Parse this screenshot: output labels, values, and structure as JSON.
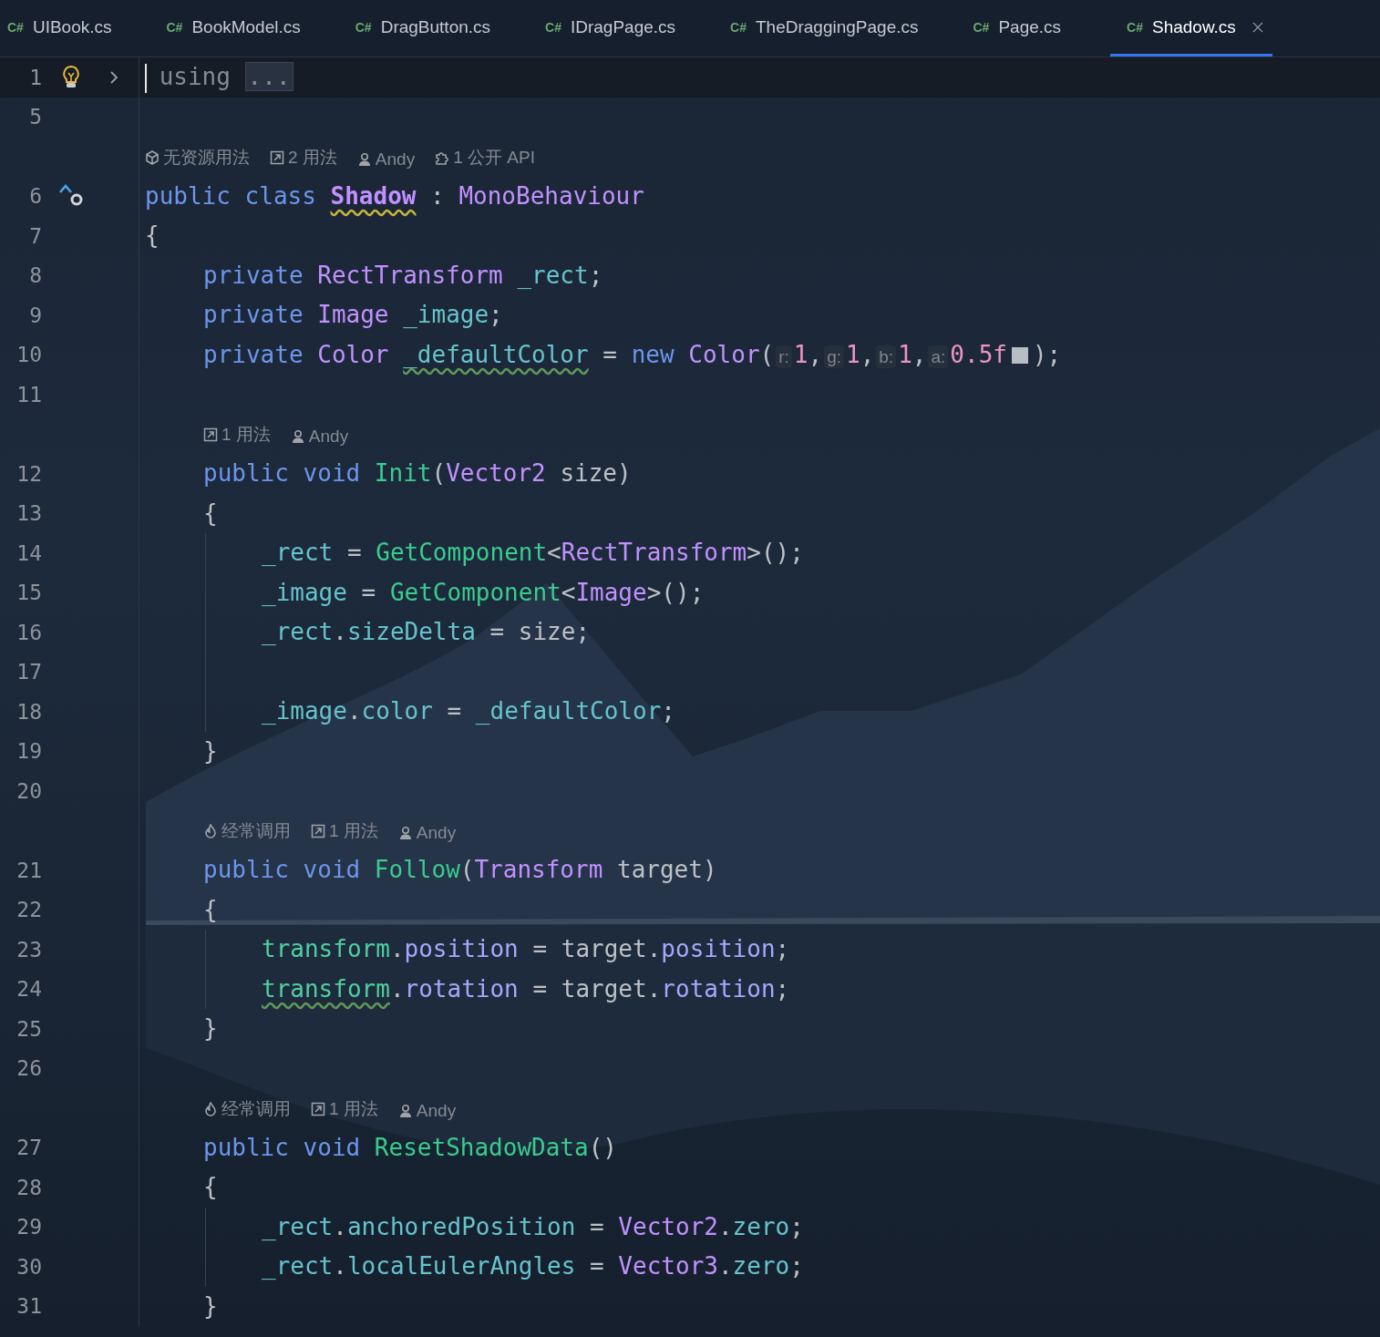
{
  "tabs": [
    {
      "icon": "C#",
      "label": "UIBook.cs",
      "selected": false
    },
    {
      "icon": "C#",
      "label": "BookModel.cs",
      "selected": false
    },
    {
      "icon": "C#",
      "label": "DragButton.cs",
      "selected": false
    },
    {
      "icon": "C#",
      "label": "IDragPage.cs",
      "selected": false
    },
    {
      "icon": "C#",
      "label": "TheDraggingPage.cs",
      "selected": false
    },
    {
      "icon": "C#",
      "label": "Page.cs",
      "selected": false
    },
    {
      "icon": "C#",
      "label": "Shadow.cs",
      "selected": true
    }
  ],
  "lines": [
    {
      "kind": "code",
      "number": "1",
      "current": true,
      "caret": true,
      "gutter": {
        "kind": "bulb"
      },
      "folded": true,
      "words": [
        [
          {
            "kind": "dim",
            "text": "using"
          }
        ],
        [
          {
            "kind": "folded",
            "text": "..."
          }
        ]
      ]
    },
    {
      "kind": "code",
      "number": "5"
    },
    {
      "kind": "hint",
      "items": [
        {
          "kind": "unity",
          "text": "无资源用法"
        },
        {
          "kind": "usages",
          "text": "2 用法"
        },
        {
          "kind": "author",
          "text": "Andy"
        },
        {
          "kind": "api",
          "text": "1 公开 API"
        }
      ]
    },
    {
      "kind": "code",
      "number": "6",
      "gutter": {
        "kind": "implements"
      },
      "words": [
        [
          {
            "kind": "keyword",
            "text": "public"
          }
        ],
        [
          {
            "kind": "keyword",
            "text": "class"
          }
        ],
        [
          {
            "kind": "class",
            "text": "Shadow",
            "warning": true
          }
        ],
        [
          {
            "kind": "plain",
            "text": ":"
          }
        ],
        [
          {
            "kind": "type",
            "text": "MonoBehaviour"
          }
        ]
      ]
    },
    {
      "kind": "code",
      "number": "7",
      "words": [
        [
          {
            "kind": "plain",
            "text": "{"
          }
        ]
      ],
      "children": [
        {
          "kind": "code",
          "number": "8",
          "words": [
            [
              {
                "kind": "keyword",
                "text": "private"
              }
            ],
            [
              {
                "kind": "type",
                "text": "RectTransform"
              }
            ],
            [
              {
                "kind": "field",
                "text": "_rect"
              },
              {
                "kind": "plain",
                "text": ";"
              }
            ]
          ]
        },
        {
          "kind": "code",
          "number": "9",
          "words": [
            [
              {
                "kind": "keyword",
                "text": "private"
              }
            ],
            [
              {
                "kind": "type",
                "text": "Image"
              }
            ],
            [
              {
                "kind": "field",
                "text": "_image"
              },
              {
                "kind": "plain",
                "text": ";"
              }
            ]
          ]
        },
        {
          "kind": "code",
          "number": "10",
          "words": [
            [
              {
                "kind": "keyword",
                "text": "private"
              }
            ],
            [
              {
                "kind": "type",
                "text": "Color"
              }
            ],
            [
              {
                "kind": "field",
                "text": "_defaultColor",
                "weak_warning": true
              }
            ],
            [
              {
                "kind": "plain",
                "text": "="
              }
            ],
            [
              {
                "kind": "keyword",
                "text": "new"
              }
            ],
            [
              {
                "kind": "type",
                "text": "Color"
              },
              {
                "kind": "plain",
                "text": "("
              },
              {
                "kind": "param",
                "text": "r:"
              },
              {
                "kind": "number",
                "text": "1"
              },
              {
                "kind": "plain",
                "text": ","
              },
              {
                "kind": "param",
                "text": "g:"
              },
              {
                "kind": "number",
                "text": "1"
              },
              {
                "kind": "plain",
                "text": ","
              },
              {
                "kind": "param",
                "text": "b:"
              },
              {
                "kind": "number",
                "text": "1"
              },
              {
                "kind": "plain",
                "text": ","
              },
              {
                "kind": "param",
                "text": "a:"
              },
              {
                "kind": "number",
                "text": "0.5f"
              },
              {
                "kind": "swatch"
              },
              {
                "kind": "plain",
                "text": ");"
              }
            ]
          ]
        },
        {
          "kind": "code",
          "number": "11"
        },
        {
          "kind": "hint",
          "items": [
            {
              "kind": "usages",
              "text": "1 用法"
            },
            {
              "kind": "author",
              "text": "Andy"
            }
          ]
        },
        {
          "kind": "code",
          "number": "12",
          "words": [
            [
              {
                "kind": "keyword",
                "text": "public"
              }
            ],
            [
              {
                "kind": "keyword",
                "text": "void"
              }
            ],
            [
              {
                "kind": "method",
                "text": "Init"
              },
              {
                "kind": "plain",
                "text": "("
              },
              {
                "kind": "type",
                "text": "Vector2"
              }
            ],
            [
              {
                "kind": "plain",
                "text": "size)"
              }
            ]
          ]
        },
        {
          "kind": "code",
          "number": "13",
          "words": [
            [
              {
                "kind": "plain",
                "text": "{"
              }
            ]
          ],
          "children": [
            {
              "kind": "code",
              "number": "14",
              "words": [
                [
                  {
                    "kind": "field",
                    "text": "_rect"
                  }
                ],
                [
                  {
                    "kind": "plain",
                    "text": "="
                  }
                ],
                [
                  {
                    "kind": "method",
                    "text": "GetComponent"
                  },
                  {
                    "kind": "plain",
                    "text": "<"
                  },
                  {
                    "kind": "type",
                    "text": "RectTransform"
                  },
                  {
                    "kind": "plain",
                    "text": ">();"
                  }
                ]
              ]
            },
            {
              "kind": "code",
              "number": "15",
              "words": [
                [
                  {
                    "kind": "field",
                    "text": "_image"
                  }
                ],
                [
                  {
                    "kind": "plain",
                    "text": "="
                  }
                ],
                [
                  {
                    "kind": "method",
                    "text": "GetComponent"
                  },
                  {
                    "kind": "plain",
                    "text": "<"
                  },
                  {
                    "kind": "type",
                    "text": "Image"
                  },
                  {
                    "kind": "plain",
                    "text": ">();"
                  }
                ]
              ]
            },
            {
              "kind": "code",
              "number": "16",
              "words": [
                [
                  {
                    "kind": "field",
                    "text": "_rect"
                  },
                  {
                    "kind": "plain",
                    "text": "."
                  },
                  {
                    "kind": "field",
                    "text": "sizeDelta"
                  }
                ],
                [
                  {
                    "kind": "plain",
                    "text": "="
                  }
                ],
                [
                  {
                    "kind": "plain",
                    "text": "size;"
                  }
                ]
              ]
            },
            {
              "kind": "code",
              "number": "17"
            },
            {
              "kind": "code",
              "number": "18",
              "words": [
                [
                  {
                    "kind": "field",
                    "text": "_image"
                  },
                  {
                    "kind": "plain",
                    "text": "."
                  },
                  {
                    "kind": "field",
                    "text": "color"
                  }
                ],
                [
                  {
                    "kind": "plain",
                    "text": "="
                  }
                ],
                [
                  {
                    "kind": "field",
                    "text": "_defaultColor"
                  },
                  {
                    "kind": "plain",
                    "text": ";"
                  }
                ]
              ]
            }
          ]
        },
        {
          "kind": "code",
          "number": "19",
          "words": [
            [
              {
                "kind": "plain",
                "text": "}"
              }
            ]
          ]
        },
        {
          "kind": "code",
          "number": "20"
        },
        {
          "kind": "hint",
          "items": [
            {
              "kind": "frequent",
              "text": "经常调用"
            },
            {
              "kind": "usages",
              "text": "1 用法"
            },
            {
              "kind": "author",
              "text": "Andy"
            }
          ]
        },
        {
          "kind": "code",
          "number": "21",
          "words": [
            [
              {
                "kind": "keyword",
                "text": "public"
              }
            ],
            [
              {
                "kind": "keyword",
                "text": "void"
              }
            ],
            [
              {
                "kind": "method",
                "text": "Follow"
              },
              {
                "kind": "plain",
                "text": "("
              },
              {
                "kind": "type",
                "text": "Transform"
              }
            ],
            [
              {
                "kind": "plain",
                "text": "target)"
              }
            ]
          ]
        },
        {
          "kind": "code",
          "number": "22",
          "words": [
            [
              {
                "kind": "plain",
                "text": "{"
              }
            ]
          ],
          "children": [
            {
              "kind": "code",
              "number": "23",
              "words": [
                [
                  {
                    "kind": "member",
                    "text": "transform"
                  },
                  {
                    "kind": "plain",
                    "text": "."
                  },
                  {
                    "kind": "property",
                    "text": "position"
                  }
                ],
                [
                  {
                    "kind": "plain",
                    "text": "="
                  }
                ],
                [
                  {
                    "kind": "plain",
                    "text": "target"
                  },
                  {
                    "kind": "plain",
                    "text": "."
                  },
                  {
                    "kind": "property",
                    "text": "position"
                  },
                  {
                    "kind": "plain",
                    "text": ";"
                  }
                ]
              ]
            },
            {
              "kind": "code",
              "number": "24",
              "words": [
                [
                  {
                    "kind": "member",
                    "text": "transform",
                    "weak_warning": true
                  },
                  {
                    "kind": "plain",
                    "text": "."
                  },
                  {
                    "kind": "property",
                    "text": "rotation"
                  }
                ],
                [
                  {
                    "kind": "plain",
                    "text": "="
                  }
                ],
                [
                  {
                    "kind": "plain",
                    "text": "target"
                  },
                  {
                    "kind": "plain",
                    "text": "."
                  },
                  {
                    "kind": "property",
                    "text": "rotation"
                  },
                  {
                    "kind": "plain",
                    "text": ";"
                  }
                ]
              ]
            }
          ]
        },
        {
          "kind": "code",
          "number": "25",
          "words": [
            [
              {
                "kind": "plain",
                "text": "}"
              }
            ]
          ]
        },
        {
          "kind": "code",
          "number": "26"
        },
        {
          "kind": "hint",
          "items": [
            {
              "kind": "frequent",
              "text": "经常调用"
            },
            {
              "kind": "usages",
              "text": "1 用法"
            },
            {
              "kind": "author",
              "text": "Andy"
            }
          ]
        },
        {
          "kind": "code",
          "number": "27",
          "words": [
            [
              {
                "kind": "keyword",
                "text": "public"
              }
            ],
            [
              {
                "kind": "keyword",
                "text": "void"
              }
            ],
            [
              {
                "kind": "method",
                "text": "ResetShadowData"
              },
              {
                "kind": "plain",
                "text": "()"
              }
            ]
          ]
        },
        {
          "kind": "code",
          "number": "28",
          "words": [
            [
              {
                "kind": "plain",
                "text": "{"
              }
            ]
          ],
          "children": [
            {
              "kind": "code",
              "number": "29",
              "words": [
                [
                  {
                    "kind": "field",
                    "text": "_rect"
                  },
                  {
                    "kind": "plain",
                    "text": "."
                  },
                  {
                    "kind": "field",
                    "text": "anchoredPosition"
                  }
                ],
                [
                  {
                    "kind": "plain",
                    "text": "="
                  }
                ],
                [
                  {
                    "kind": "type",
                    "text": "Vector2"
                  },
                  {
                    "kind": "plain",
                    "text": "."
                  },
                  {
                    "kind": "field",
                    "text": "zero"
                  },
                  {
                    "kind": "plain",
                    "text": ";"
                  }
                ]
              ]
            },
            {
              "kind": "code",
              "number": "30",
              "words": [
                [
                  {
                    "kind": "field",
                    "text": "_rect"
                  },
                  {
                    "kind": "plain",
                    "text": "."
                  },
                  {
                    "kind": "field",
                    "text": "localEulerAngles"
                  }
                ],
                [
                  {
                    "kind": "plain",
                    "text": "="
                  }
                ],
                [
                  {
                    "kind": "type",
                    "text": "Vector3"
                  },
                  {
                    "kind": "plain",
                    "text": "."
                  },
                  {
                    "kind": "field",
                    "text": "zero"
                  },
                  {
                    "kind": "plain",
                    "text": ";"
                  }
                ]
              ]
            }
          ]
        },
        {
          "kind": "code",
          "number": "31",
          "words": [
            [
              {
                "kind": "plain",
                "text": "}"
              }
            ]
          ]
        }
      ]
    }
  ]
}
